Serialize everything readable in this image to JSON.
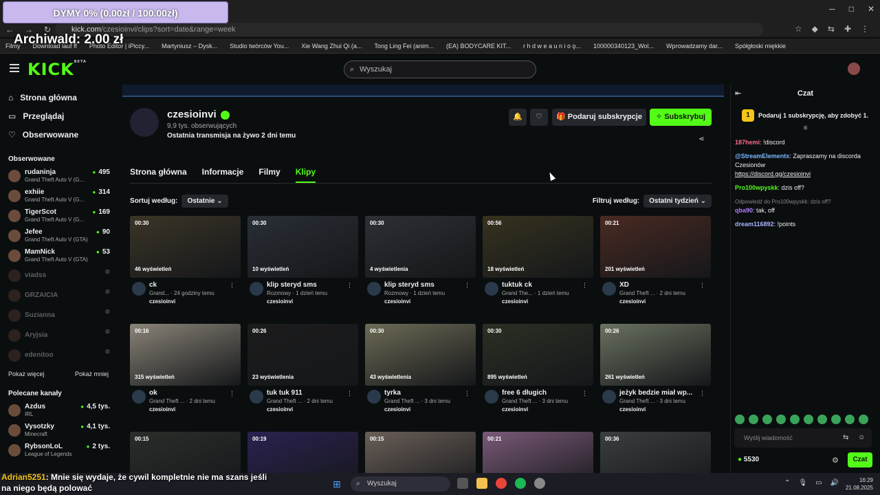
{
  "browser": {
    "url_main": "kick.com",
    "url_tail": "/czesioinvi/clips?sort=date&range=week",
    "bookmarks": [
      "Filmy",
      "Download lauf ff",
      "Photo Editor | iPiccy...",
      "Martyniusz – Dysk...",
      "Studio twórców You...",
      "Xie Wang Zhui Qi (a...",
      "Tong Ling Fei (anim...",
      "(EA) BODYCARE KIT...",
      "r h d w e a u n i o ǫ...",
      "100000340123_Wol...",
      "Wprowadzamy dar...",
      "Spółgłoski miękkie"
    ]
  },
  "overlays": {
    "donate_bar": "DYMY 0% (0.00zł / 100.00zł)",
    "archiwald": "Archiwald: 2.00 zł",
    "chat_author": "Adrian5251",
    "chat_text": ": Mnie się wydaje, że cywil kompletnie nie ma szans jeśli na niego będą polować"
  },
  "header": {
    "logo": "KICK",
    "logo_beta": "BETA",
    "search_placeholder": "Wyszukaj"
  },
  "sidebar": {
    "nav": [
      {
        "label": "Strona główna",
        "icon": "home-icon"
      },
      {
        "label": "Przeglądaj",
        "icon": "browse-icon"
      },
      {
        "label": "Obserwowane",
        "icon": "heart-icon"
      }
    ],
    "followed_title": "Obserwowane",
    "followed": [
      {
        "name": "rudaninja",
        "game": "Grand Theft Auto V (G...",
        "viewers": "495"
      },
      {
        "name": "exhiie",
        "game": "Grand Theft Auto V (G...",
        "viewers": "314"
      },
      {
        "name": "TigerScot",
        "game": "Grand Theft Auto V (G...",
        "viewers": "169"
      },
      {
        "name": "Jefee",
        "game": "Grand Theft Auto V (GTA)",
        "viewers": "90"
      },
      {
        "name": "MamNick",
        "game": "Grand Theft Auto V (GTA)",
        "viewers": "53"
      }
    ],
    "offline": [
      "viadss",
      "GRZAICIA",
      "Suzianna",
      "Aryjsia",
      "edenitoo"
    ],
    "show_more": "Pokaż więcej",
    "show_less": "Pokaż mniej",
    "recommended_title": "Polecane kanały",
    "recommended": [
      {
        "name": "Azdus",
        "game": "IRL",
        "viewers": "4,5 tys."
      },
      {
        "name": "Vysotzky",
        "game": "Minecraft",
        "viewers": "4,1 tys."
      },
      {
        "name": "RybsonLoL",
        "game": "League of Legends",
        "viewers": "2 tys."
      }
    ]
  },
  "channel": {
    "name": "czesioinvi",
    "followers": "9,9 tys. obserwujących",
    "last_stream": "Ostatnia transmisja na żywo 2 dni temu",
    "gift_label": "Podaruj subskrypcje",
    "subscribe_label": "Subskrybuj",
    "tabs": [
      "Strona główna",
      "Informacje",
      "Filmy",
      "Klipy"
    ],
    "active_tab": "Klipy",
    "sort_label": "Sortuj według:",
    "sort_value": "Ostatnie",
    "filter_label": "Filtruj według:",
    "filter_value": "Ostatni tydzień"
  },
  "clips": [
    {
      "dur": "00:30",
      "views": "46 wyświetleń",
      "title": "ck",
      "meta": "Grand... · 24 godziny temu",
      "channel": "czesioinvi",
      "color": "#3b3527"
    },
    {
      "dur": "00:30",
      "views": "10 wyświetleń",
      "title": "klip steryd sms",
      "meta": "Rozmowy · 1 dzień temu",
      "channel": "czesioinvi",
      "color": "#2a2f36"
    },
    {
      "dur": "00:30",
      "views": "4 wyświetlenia",
      "title": "klip steryd sms",
      "meta": "Rozmowy · 1 dzień temu",
      "channel": "czesioinvi",
      "color": "#2c3034"
    },
    {
      "dur": "00:56",
      "views": "18 wyświetleń",
      "title": "tuktuk ck",
      "meta": "Grand The... · 1 dzień temu",
      "channel": "czesioinvi",
      "color": "#37321f"
    },
    {
      "dur": "00:21",
      "views": "201 wyświetleń",
      "title": "XD",
      "meta": "Grand Theft ... · 2 dni temu",
      "channel": "czesioinvi",
      "color": "#4a2a22"
    },
    {
      "dur": "00:16",
      "views": "315 wyświetleń",
      "title": "ok",
      "meta": "Grand Theft ... · 2 dni temu",
      "channel": "czesioinvi",
      "color": "#8a8478"
    },
    {
      "dur": "00:26",
      "views": "23 wyświetlenia",
      "title": "tuk tuk 911",
      "meta": "Grand Theft ... · 2 dni temu",
      "channel": "czesioinvi",
      "color": "#1c1c1c"
    },
    {
      "dur": "00:30",
      "views": "43 wyświetlenia",
      "title": "tyrka",
      "meta": "Grand Theft ... · 3 dni temu",
      "channel": "czesioinvi",
      "color": "#6d6a55"
    },
    {
      "dur": "00:30",
      "views": "895 wyświetleń",
      "title": "free 6 długich",
      "meta": "Grand Theft ... · 3 dni temu",
      "channel": "czesioinvi",
      "color": "#2b3024"
    },
    {
      "dur": "00:26",
      "views": "261 wyświetleń",
      "title": "jeżyk bedzie miał wp...",
      "meta": "Grand Theft ... · 3 dni temu",
      "channel": "czesioinvi",
      "color": "#6a7260"
    },
    {
      "dur": "00:15",
      "views": "",
      "title": "",
      "meta": "",
      "channel": "",
      "color": "#2a2e2a"
    },
    {
      "dur": "00:19",
      "views": "",
      "title": "",
      "meta": "",
      "channel": "",
      "color": "#2a2250"
    },
    {
      "dur": "00:15",
      "views": "",
      "title": "",
      "meta": "",
      "channel": "",
      "color": "#6a5f58"
    },
    {
      "dur": "00:21",
      "views": "",
      "title": "",
      "meta": "",
      "channel": "",
      "color": "#7a5a78"
    },
    {
      "dur": "00:36",
      "views": "",
      "title": "",
      "meta": "",
      "channel": "",
      "color": "#3a3e40"
    }
  ],
  "chat": {
    "title": "Czat",
    "gift_banner": "Podaruj 1 subskrypcję, aby zdobyć 1.",
    "messages": [
      {
        "user": "187hemi",
        "text": ": !discord"
      },
      {
        "user": "@StreamElements",
        "text": ": Zapraszamy na discorda Czesionów"
      },
      {
        "user": "Pro100wpyskk",
        "text": ": dzis off?"
      },
      {
        "reply": "Odpowiedź do Pro100wpyskk: dzis off?",
        "user": "qba90",
        "text": ": tak, off"
      },
      {
        "user": "dream116892",
        "text": ": !points"
      }
    ],
    "link": "https://discord.gg/czesioinvi",
    "input_placeholder": "Wyślij wiadomość",
    "points": "5530",
    "send_label": "Czat"
  },
  "taskbar": {
    "search": "Wyszukaj",
    "time": "16:29",
    "date": "21.08.2025"
  }
}
